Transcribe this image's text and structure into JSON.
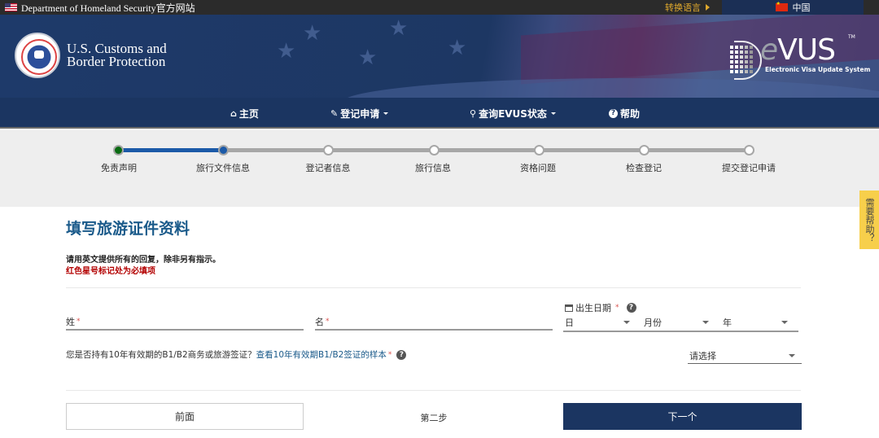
{
  "topbar": {
    "agency": "Department of Homeland Security官方网站",
    "switch_language": "转换语言",
    "current_language": "中国"
  },
  "header": {
    "cbp_line1": "U.S. Customs and",
    "cbp_line2": "Border Protection",
    "evus_e": "e",
    "evus_rest": "VUS",
    "evus_tm": "TM",
    "evus_subtitle": "Electronic Visa Update System"
  },
  "nav": {
    "items": [
      {
        "label": "主页",
        "icon": "home-icon"
      },
      {
        "label": "登记申请",
        "icon": "pencil-icon",
        "dropdown": true
      },
      {
        "label": "查询EVUS状态",
        "icon": "search-icon",
        "dropdown": true
      },
      {
        "label": "帮助",
        "icon": "question-circle-icon"
      }
    ]
  },
  "progress": {
    "current_step": 2,
    "steps": [
      {
        "label": "免责声明",
        "state": "complete"
      },
      {
        "label": "旅行文件信息",
        "state": "current"
      },
      {
        "label": "登记者信息",
        "state": "pending"
      },
      {
        "label": "旅行信息",
        "state": "pending"
      },
      {
        "label": "资格问题",
        "state": "pending"
      },
      {
        "label": "检查登记",
        "state": "pending"
      },
      {
        "label": "提交登记申请",
        "state": "pending"
      }
    ]
  },
  "help_tab": "需要帮助？",
  "form": {
    "title": "填写旅游证件资料",
    "instruction": "请用英文提供所有的回复，除非另有指示。",
    "required_note": "红色星号标记处为必填项",
    "surname_label": "姓",
    "given_name_label": "名",
    "surname_value": "",
    "given_name_value": "",
    "required_mark": "*",
    "dob": {
      "label": "出生日期",
      "day_placeholder": "日",
      "month_placeholder": "月份",
      "year_placeholder": "年"
    },
    "visa_question": {
      "text": "您是否持有10年有效期的B1/B2商务或旅游签证？",
      "link": "查看10年有效期B1/B2签证的样本",
      "select_value": "请选择"
    }
  },
  "footer": {
    "prev_label": "前面",
    "step_label": "第二步",
    "next_label": "下一个"
  },
  "colors": {
    "nav_bg": "#1b3561",
    "progress_done": "#1c5aa8",
    "step_complete": "#0a6b12",
    "required": "#d9534f",
    "title": "#1a5a8a",
    "help_tab": "#f7cf4b",
    "switch_language": "#e0a92c"
  }
}
